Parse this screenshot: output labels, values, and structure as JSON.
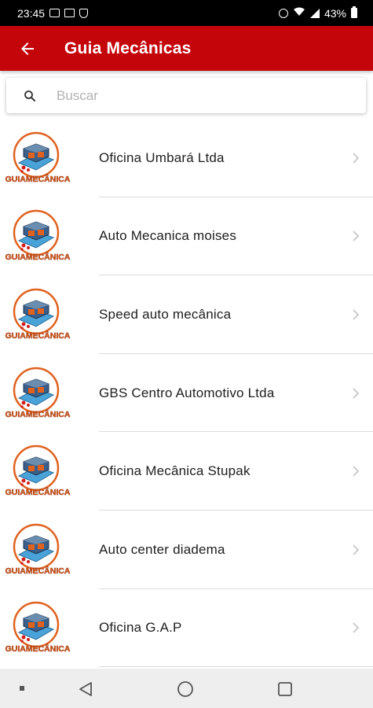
{
  "status_bar": {
    "time": "23:45",
    "battery": "43%"
  },
  "app_bar": {
    "title": "Guia Mecânicas"
  },
  "search": {
    "placeholder": "Buscar",
    "value": ""
  },
  "logo": {
    "text": "GUIAMECÂNICA"
  },
  "items": [
    {
      "label": "Oficina Umbará Ltda"
    },
    {
      "label": "Auto Mecanica moises"
    },
    {
      "label": "Speed auto mecânica"
    },
    {
      "label": "GBS Centro Automotivo Ltda"
    },
    {
      "label": "Oficina Mecânica Stupak"
    },
    {
      "label": "Auto center diadema"
    },
    {
      "label": "Oficina G.A.P"
    }
  ],
  "colors": {
    "accent": "#c4060b",
    "logo_orange": "#e0621e",
    "logo_red": "#d11d1d"
  }
}
